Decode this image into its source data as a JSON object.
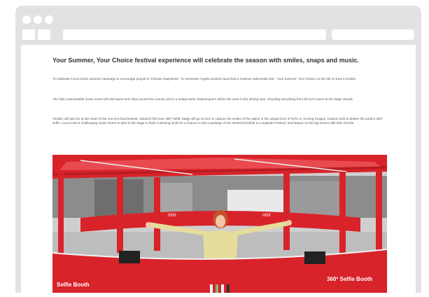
{
  "browser": {
    "frame_color": "#e2e2e2",
    "icons": [
      "window-dot-icon",
      "window-dot-icon",
      "window-dot-icon"
    ]
  },
  "article": {
    "headline": "Your Summer, Your Choice festival experience will celebrate the season with smiles, snaps and music.",
    "paragraphs": [
      "To celebrate Coca-Cola's summer campaign to encourage people to 'Choose Happiness', TV presenter Angela Scanlon launched a massive nationwide tour - Your Summer, Your Choice on the 4th of June in Dublin.",
      "The fully customisable music event will visit towns and cities across the country and in a unique twist, festival-goers will be the ones in the driving seat, choosing everything from the DJ's tunes to the stage visuals.",
      "'Smiles' will also be at the heart of this one-of-a-kind festival, Ireland's first ever 360º Selfie Stage will go on tour to capture the smiles of the nation in the unique form of GIFs or 'moving' images. Custom built to deliver the perfect 360º selfie, Coca-Cola is challenging music-lovers to take to the stage to flash a winning smile for a chance to win a package of ten weekend tickets to Longitude Festival, and feature on the big screen with their friends."
    ],
    "photo": {
      "stand_text_left": "Selfie Booth",
      "stand_text_right": "360º Selfie Booth",
      "brand_color": "#d8232a"
    }
  }
}
